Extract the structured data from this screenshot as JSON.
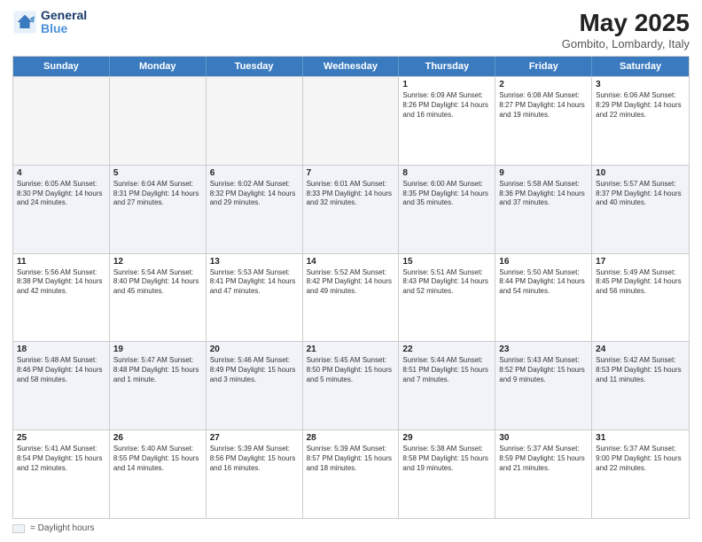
{
  "header": {
    "logo_line1": "General",
    "logo_line2": "Blue",
    "month": "May 2025",
    "location": "Gombito, Lombardy, Italy"
  },
  "weekdays": [
    "Sunday",
    "Monday",
    "Tuesday",
    "Wednesday",
    "Thursday",
    "Friday",
    "Saturday"
  ],
  "legend": {
    "box_label": "= Daylight hours"
  },
  "rows": [
    [
      {
        "day": "",
        "info": "",
        "empty": true
      },
      {
        "day": "",
        "info": "",
        "empty": true
      },
      {
        "day": "",
        "info": "",
        "empty": true
      },
      {
        "day": "",
        "info": "",
        "empty": true
      },
      {
        "day": "1",
        "info": "Sunrise: 6:09 AM\nSunset: 8:26 PM\nDaylight: 14 hours\nand 16 minutes."
      },
      {
        "day": "2",
        "info": "Sunrise: 6:08 AM\nSunset: 8:27 PM\nDaylight: 14 hours\nand 19 minutes."
      },
      {
        "day": "3",
        "info": "Sunrise: 6:06 AM\nSunset: 8:29 PM\nDaylight: 14 hours\nand 22 minutes."
      }
    ],
    [
      {
        "day": "4",
        "info": "Sunrise: 6:05 AM\nSunset: 8:30 PM\nDaylight: 14 hours\nand 24 minutes."
      },
      {
        "day": "5",
        "info": "Sunrise: 6:04 AM\nSunset: 8:31 PM\nDaylight: 14 hours\nand 27 minutes."
      },
      {
        "day": "6",
        "info": "Sunrise: 6:02 AM\nSunset: 8:32 PM\nDaylight: 14 hours\nand 29 minutes."
      },
      {
        "day": "7",
        "info": "Sunrise: 6:01 AM\nSunset: 8:33 PM\nDaylight: 14 hours\nand 32 minutes."
      },
      {
        "day": "8",
        "info": "Sunrise: 6:00 AM\nSunset: 8:35 PM\nDaylight: 14 hours\nand 35 minutes."
      },
      {
        "day": "9",
        "info": "Sunrise: 5:58 AM\nSunset: 8:36 PM\nDaylight: 14 hours\nand 37 minutes."
      },
      {
        "day": "10",
        "info": "Sunrise: 5:57 AM\nSunset: 8:37 PM\nDaylight: 14 hours\nand 40 minutes."
      }
    ],
    [
      {
        "day": "11",
        "info": "Sunrise: 5:56 AM\nSunset: 8:38 PM\nDaylight: 14 hours\nand 42 minutes."
      },
      {
        "day": "12",
        "info": "Sunrise: 5:54 AM\nSunset: 8:40 PM\nDaylight: 14 hours\nand 45 minutes."
      },
      {
        "day": "13",
        "info": "Sunrise: 5:53 AM\nSunset: 8:41 PM\nDaylight: 14 hours\nand 47 minutes."
      },
      {
        "day": "14",
        "info": "Sunrise: 5:52 AM\nSunset: 8:42 PM\nDaylight: 14 hours\nand 49 minutes."
      },
      {
        "day": "15",
        "info": "Sunrise: 5:51 AM\nSunset: 8:43 PM\nDaylight: 14 hours\nand 52 minutes."
      },
      {
        "day": "16",
        "info": "Sunrise: 5:50 AM\nSunset: 8:44 PM\nDaylight: 14 hours\nand 54 minutes."
      },
      {
        "day": "17",
        "info": "Sunrise: 5:49 AM\nSunset: 8:45 PM\nDaylight: 14 hours\nand 56 minutes."
      }
    ],
    [
      {
        "day": "18",
        "info": "Sunrise: 5:48 AM\nSunset: 8:46 PM\nDaylight: 14 hours\nand 58 minutes."
      },
      {
        "day": "19",
        "info": "Sunrise: 5:47 AM\nSunset: 8:48 PM\nDaylight: 15 hours\nand 1 minute."
      },
      {
        "day": "20",
        "info": "Sunrise: 5:46 AM\nSunset: 8:49 PM\nDaylight: 15 hours\nand 3 minutes."
      },
      {
        "day": "21",
        "info": "Sunrise: 5:45 AM\nSunset: 8:50 PM\nDaylight: 15 hours\nand 5 minutes."
      },
      {
        "day": "22",
        "info": "Sunrise: 5:44 AM\nSunset: 8:51 PM\nDaylight: 15 hours\nand 7 minutes."
      },
      {
        "day": "23",
        "info": "Sunrise: 5:43 AM\nSunset: 8:52 PM\nDaylight: 15 hours\nand 9 minutes."
      },
      {
        "day": "24",
        "info": "Sunrise: 5:42 AM\nSunset: 8:53 PM\nDaylight: 15 hours\nand 11 minutes."
      }
    ],
    [
      {
        "day": "25",
        "info": "Sunrise: 5:41 AM\nSunset: 8:54 PM\nDaylight: 15 hours\nand 12 minutes."
      },
      {
        "day": "26",
        "info": "Sunrise: 5:40 AM\nSunset: 8:55 PM\nDaylight: 15 hours\nand 14 minutes."
      },
      {
        "day": "27",
        "info": "Sunrise: 5:39 AM\nSunset: 8:56 PM\nDaylight: 15 hours\nand 16 minutes."
      },
      {
        "day": "28",
        "info": "Sunrise: 5:39 AM\nSunset: 8:57 PM\nDaylight: 15 hours\nand 18 minutes."
      },
      {
        "day": "29",
        "info": "Sunrise: 5:38 AM\nSunset: 8:58 PM\nDaylight: 15 hours\nand 19 minutes."
      },
      {
        "day": "30",
        "info": "Sunrise: 5:37 AM\nSunset: 8:59 PM\nDaylight: 15 hours\nand 21 minutes."
      },
      {
        "day": "31",
        "info": "Sunrise: 5:37 AM\nSunset: 9:00 PM\nDaylight: 15 hours\nand 22 minutes."
      }
    ]
  ]
}
